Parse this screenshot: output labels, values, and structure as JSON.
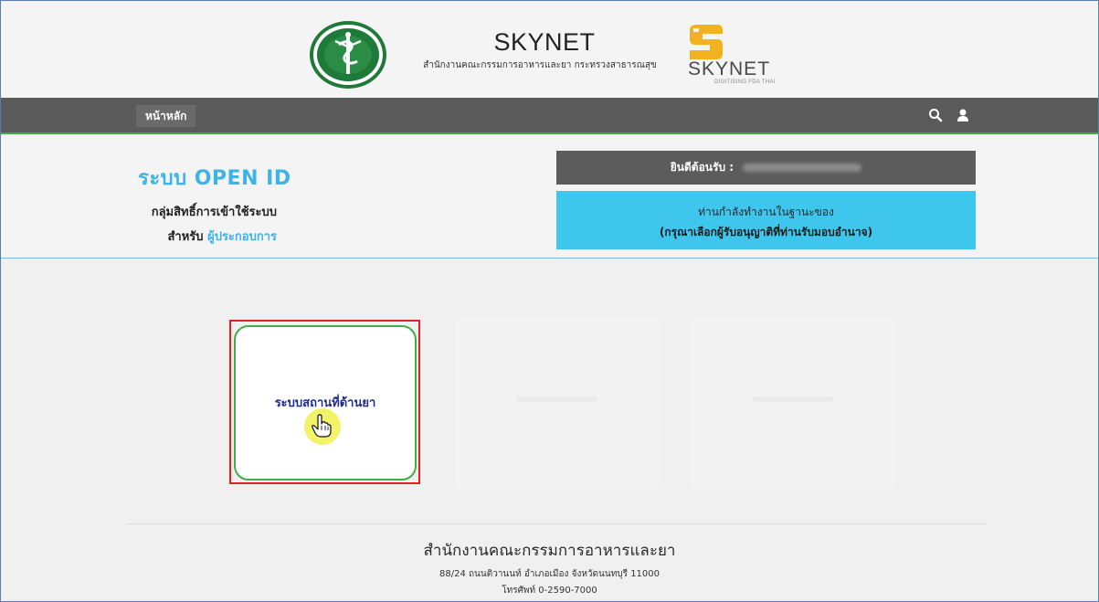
{
  "header": {
    "title": "SKYNET",
    "subtitle": "สำนักงานคณะกรรมการอาหารและยา กระทรวงสาธารณสุข",
    "brand_wordmark": "SKYNET",
    "brand_tagline": "DIGITISING FDA THAI"
  },
  "navbar": {
    "home_label": "หน้าหลัก",
    "icons": [
      "search-icon",
      "user-icon"
    ]
  },
  "welcome": {
    "system_title": "ระบบ OPEN ID",
    "group_label": "กลุ่มสิทธิ์การเข้าใช้ระบบ",
    "for_prefix": "สำหรับ",
    "for_link": "ผู้ประกอบการ",
    "greeting": "ยินดีต้อนรับ :",
    "role_line1": "ท่านกำลังทำงานในฐานะของ",
    "role_line2": "(กรุณาเลือกผู้รับอนุญาติที่ท่านรับมอบอำนาจ)"
  },
  "cards": [
    {
      "label": "ระบบสถานที่ด้านยา"
    }
  ],
  "footer": {
    "title": "สำนักงานคณะกรรมการอาหารและยา",
    "address": "88/24 ถนนติวานนท์ อำเภอเมือง จังหวัดนนทบุรี 11000",
    "phone": "โทรศัพท์ 0-2590-7000"
  },
  "colors": {
    "accent": "#3db4e5",
    "nav": "#5a5a5a",
    "green": "#3fae49",
    "role_box": "#3ec6ec",
    "highlight": "#e02020"
  }
}
